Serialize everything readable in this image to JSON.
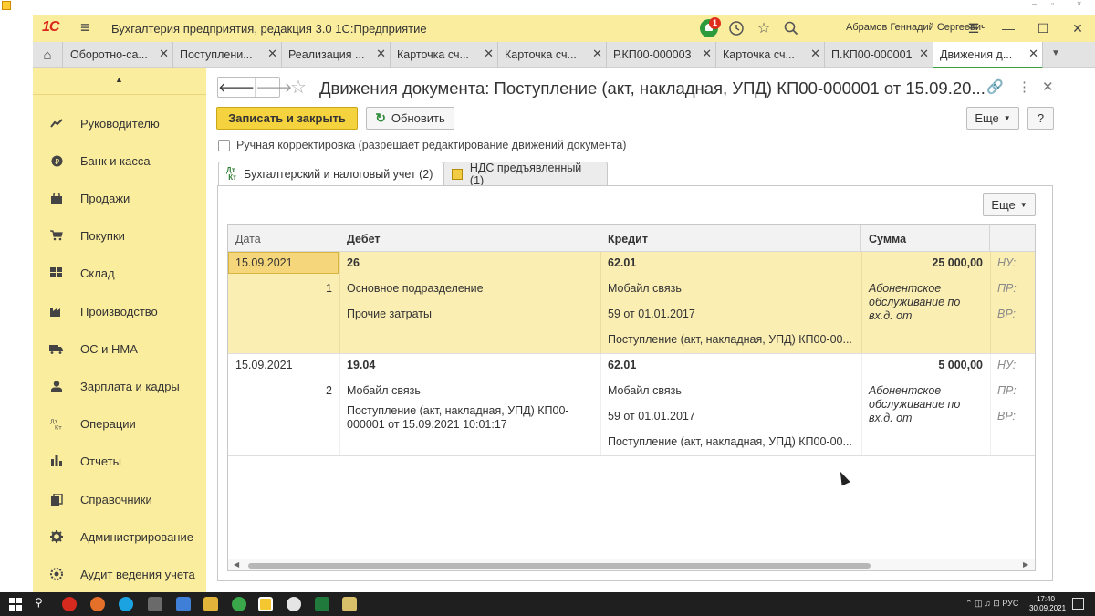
{
  "window": {
    "app_title": "Бухгалтерия предприятия, редакция 3.0 1С:Предприятие",
    "logo": "1С",
    "user": "Абрамов Геннадий Сергеевич",
    "notifications_count": "1"
  },
  "tabs": [
    {
      "label": "Оборотно-са...",
      "active": false
    },
    {
      "label": "Поступлени...",
      "active": false
    },
    {
      "label": "Реализация ...",
      "active": false
    },
    {
      "label": "Карточка сч...",
      "active": false
    },
    {
      "label": "Карточка сч...",
      "active": false
    },
    {
      "label": "Р.КП00-000003",
      "active": false
    },
    {
      "label": "Карточка сч...",
      "active": false
    },
    {
      "label": "П.КП00-000001",
      "active": false
    },
    {
      "label": "Движения д...",
      "active": true
    }
  ],
  "sidebar": {
    "items": [
      {
        "label": "Руководителю",
        "icon": "chart-line-icon"
      },
      {
        "label": "Банк и касса",
        "icon": "ruble-coin-icon"
      },
      {
        "label": "Продажи",
        "icon": "shopping-bag-icon"
      },
      {
        "label": "Покупки",
        "icon": "cart-icon"
      },
      {
        "label": "Склад",
        "icon": "warehouse-icon"
      },
      {
        "label": "Производство",
        "icon": "factory-icon"
      },
      {
        "label": "ОС и НМА",
        "icon": "truck-icon"
      },
      {
        "label": "Зарплата и кадры",
        "icon": "person-icon"
      },
      {
        "label": "Операции",
        "icon": "dt-kt-icon"
      },
      {
        "label": "Отчеты",
        "icon": "bar-chart-icon"
      },
      {
        "label": "Справочники",
        "icon": "books-icon"
      },
      {
        "label": "Администрирование",
        "icon": "gear-icon"
      },
      {
        "label": "Аудит ведения учета",
        "icon": "audit-icon"
      }
    ]
  },
  "form": {
    "title": "Движения документа: Поступление (акт, накладная, УПД) КП00-000001 от 15.09.20...",
    "save_close_label": "Записать и закрыть",
    "refresh_label": "Обновить",
    "more_label": "Еще",
    "help_label": "?",
    "manual_adjust_label": "Ручная корректировка (разрешает редактирование движений документа)",
    "form_tabs": [
      {
        "label": "Бухгалтерский и налоговый учет (2)",
        "active": true
      },
      {
        "label": "НДС предъявленный (1)",
        "active": false
      }
    ],
    "panel_more_label": "Еще"
  },
  "grid": {
    "columns": [
      "Дата",
      "Дебет",
      "Кредит",
      "Сумма"
    ],
    "rows": [
      {
        "date": "15.09.2021",
        "num": "1",
        "debit_account": "26",
        "debit_sub1": "Основное подразделение",
        "debit_sub2": "Прочие затраты",
        "credit_account": "62.01",
        "credit_sub1": "Мобайл связь",
        "credit_sub2": "59 от 01.01.2017",
        "credit_sub3": "Поступление (акт, накладная, УПД) КП00-00...",
        "amount": "25 000,00",
        "content": "Абонентское обслуживание по вх.д.  от",
        "nu": "НУ:",
        "pr": "ПР:",
        "vr": "ВР:"
      },
      {
        "date": "15.09.2021",
        "num": "2",
        "debit_account": "19.04",
        "debit_sub1": "Мобайл связь",
        "debit_sub2": "Поступление (акт, накладная, УПД) КП00-000001 от 15.09.2021 10:01:17",
        "credit_account": "62.01",
        "credit_sub1": "Мобайл связь",
        "credit_sub2": "59 от 01.01.2017",
        "credit_sub3": "Поступление (акт, накладная, УПД) КП00-00...",
        "amount": "5 000,00",
        "content": "Абонентское обслуживание по вх.д.  от",
        "nu": "НУ:",
        "pr": "ПР:",
        "vr": "ВР:"
      }
    ]
  },
  "taskbar": {
    "lang": "РУС",
    "time": "17:40",
    "date": "30.09.2021"
  },
  "colors": {
    "accent_yellow": "#fbed9e",
    "primary_button": "#f5d33f",
    "selected_row": "#fbeeb3",
    "logo_red": "#d9261c",
    "notification_green": "#2d9b3c"
  }
}
